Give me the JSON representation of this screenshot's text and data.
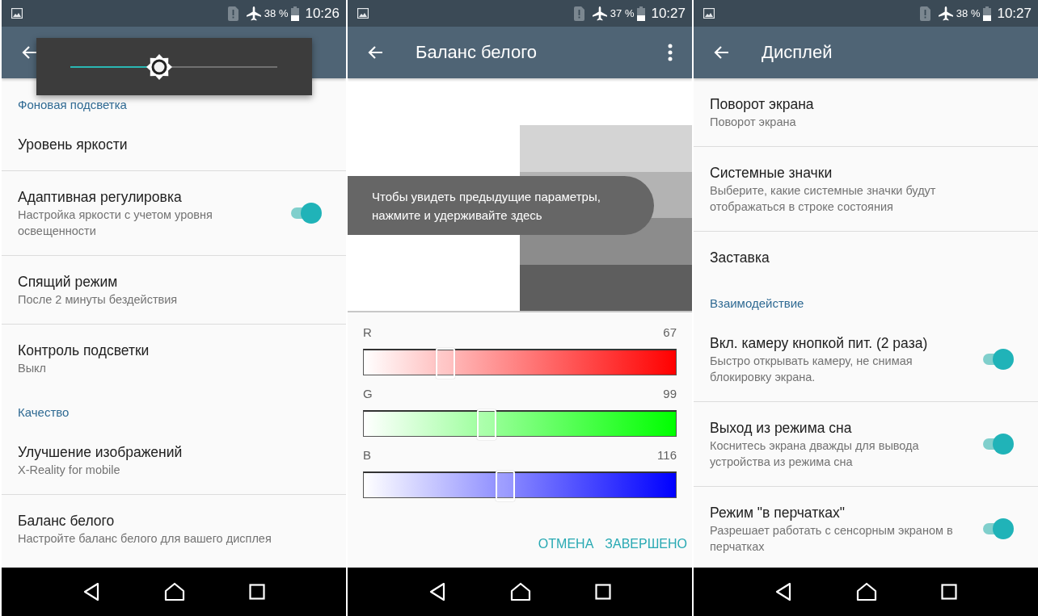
{
  "screens": [
    {
      "kind": "settings",
      "status_bar": {
        "battery": "38 %",
        "time": "10:26"
      },
      "app_bar": {
        "back": true
      },
      "brightness_popup": {
        "level": 0.43
      },
      "items": [
        {
          "kind": "section",
          "title": "Фоновая подсветка"
        },
        {
          "kind": "item",
          "title": "Уровень яркости"
        },
        {
          "kind": "item",
          "title": "Адаптивная регулировка",
          "subtitle": "Настройка яркости с учетом уровня освещенности",
          "switch": {
            "on": true
          }
        },
        {
          "kind": "item",
          "title": "Спящий режим",
          "subtitle": "После 2 минуты бездействия"
        },
        {
          "kind": "item",
          "title": "Контроль подсветки",
          "subtitle": "Выкл"
        },
        {
          "kind": "section",
          "title": "Качество"
        },
        {
          "kind": "item",
          "title": "Улучшение изображений",
          "subtitle": "X-Reality for mobile"
        },
        {
          "kind": "item",
          "title": "Баланс белого",
          "subtitle": "Настройте баланс белого для вашего дисплея"
        }
      ]
    },
    {
      "kind": "white_balance",
      "status_bar": {
        "battery": "37 %",
        "time": "10:27"
      },
      "app_bar": {
        "back": true,
        "title": "Баланс белого",
        "menu": true
      },
      "preview": {
        "swatches": [
          {
            "color": "#d4d4d4"
          },
          {
            "color": "#b3b3b3"
          },
          {
            "color": "#8c8c8c"
          },
          {
            "color": "#5e5e5e"
          }
        ],
        "toast": "Чтобы увидеть предыдущие параметры, нажмите и удерживайте здесь"
      },
      "channels": [
        {
          "label": "R",
          "value": "67",
          "level": 0.26,
          "color": "#ff0000"
        },
        {
          "label": "G",
          "value": "99",
          "level": 0.39,
          "color": "#00ff00"
        },
        {
          "label": "B",
          "value": "116",
          "level": 0.45,
          "color": "#0000ff"
        }
      ],
      "buttons": [
        "ОТМЕНА",
        "ЗАВЕРШЕНО"
      ]
    },
    {
      "kind": "settings",
      "status_bar": {
        "battery": "38 %",
        "time": "10:27"
      },
      "app_bar": {
        "back": true,
        "title": "Дисплей"
      },
      "items": [
        {
          "kind": "item",
          "title": "Поворот экрана",
          "subtitle": "Поворот экрана"
        },
        {
          "kind": "item",
          "title": "Системные значки",
          "subtitle": "Выберите, какие системные значки будут отображаться в строке состояния"
        },
        {
          "kind": "item",
          "title": "Заставка"
        },
        {
          "kind": "section",
          "title": "Взаимодействие"
        },
        {
          "kind": "item",
          "title": "Вкл. камеру кнопкой пит. (2 раза)",
          "subtitle": "Быстро открывать камеру, не снимая блокировку экрана.",
          "switch": {
            "on": true
          }
        },
        {
          "kind": "item",
          "title": "Выход из режима сна",
          "subtitle": "Коснитесь экрана дважды для вывода устройства из режима сна",
          "switch": {
            "on": true
          }
        },
        {
          "kind": "item",
          "title": "Режим \"в перчатках\"",
          "subtitle": "Разрешает работать с сенсорным экраном в перчатках",
          "switch": {
            "on": true
          }
        }
      ]
    }
  ]
}
